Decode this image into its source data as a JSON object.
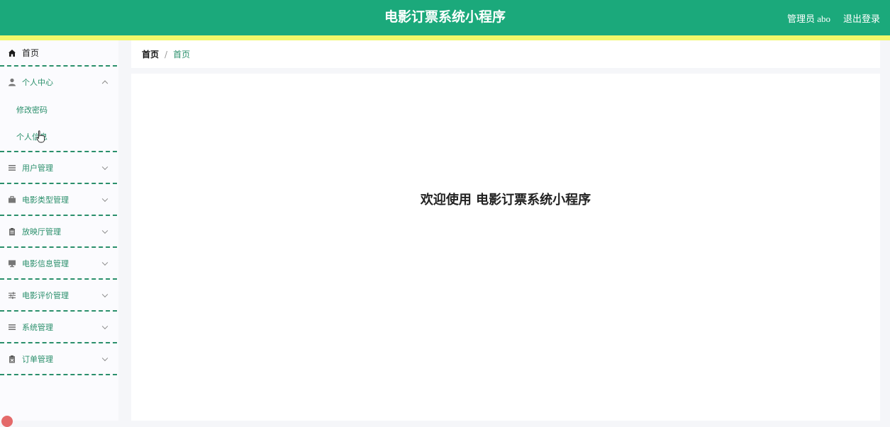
{
  "header": {
    "title": "电影订票系统小程序",
    "user_label": "管理员 abo",
    "logout_label": "退出登录",
    "bg_color": "#1ba97b",
    "strip_color": "#f2f76a"
  },
  "sidebar": {
    "home": {
      "label": "首页",
      "icon": "home-icon"
    },
    "items": [
      {
        "label": "个人中心",
        "icon": "user-icon",
        "expanded": true,
        "children": [
          {
            "label": "修改密码"
          },
          {
            "label": "个人信息"
          }
        ]
      },
      {
        "label": "用户管理",
        "icon": "list-icon"
      },
      {
        "label": "电影类型管理",
        "icon": "briefcase-icon"
      },
      {
        "label": "放映厅管理",
        "icon": "clipboard-icon"
      },
      {
        "label": "电影信息管理",
        "icon": "monitor-icon"
      },
      {
        "label": "电影评价管理",
        "icon": "sliders-icon"
      },
      {
        "label": "系统管理",
        "icon": "list-icon"
      },
      {
        "label": "订单管理",
        "icon": "clipboard-icon"
      }
    ],
    "accent_color": "#2a8f6b"
  },
  "breadcrumb": {
    "first": "首页",
    "separator": "/",
    "current": "首页"
  },
  "main": {
    "welcome": "欢迎使用 电影订票系统小程序"
  }
}
